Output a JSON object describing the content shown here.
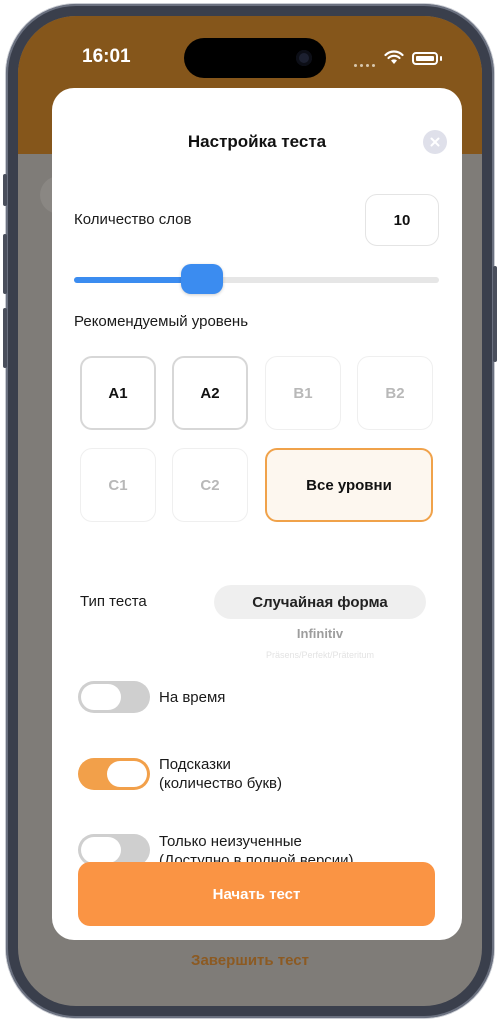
{
  "status_bar": {
    "time": "16:01"
  },
  "background": {
    "finish_label": "Завершить тест"
  },
  "modal": {
    "title": "Настройка теста",
    "word_count": {
      "label": "Количество слов",
      "value": "10",
      "slider_fraction": 0.35
    },
    "level": {
      "label": "Рекомендуемый уровень",
      "options": [
        {
          "label": "A1",
          "state": "enabled"
        },
        {
          "label": "A2",
          "state": "enabled"
        },
        {
          "label": "B1",
          "state": "disabled"
        },
        {
          "label": "B2",
          "state": "disabled"
        },
        {
          "label": "C1",
          "state": "disabled"
        },
        {
          "label": "C2",
          "state": "disabled"
        },
        {
          "label": "Все уровни",
          "state": "selected"
        }
      ]
    },
    "test_type": {
      "label": "Тип теста",
      "selected": "Случайная форма",
      "next_option": "Infinitiv",
      "faint_option": "Präsens/Perfekt/Präteritum"
    },
    "toggles": [
      {
        "label": "На время",
        "on": false
      },
      {
        "label_line1": "Подсказки",
        "label_line2": "(количество букв)",
        "on": true
      },
      {
        "label_line1": "Только неизученные",
        "label_line2": "(Доступно в полной версии)",
        "on": false
      }
    ],
    "start_button": "Начать тест"
  },
  "colors": {
    "accent_orange": "#fa9444",
    "slider_blue": "#3b8cf0",
    "header_brown": "#85561b",
    "selected_border": "#f0a24a"
  },
  "icons": [
    "close-icon",
    "wifi-icon",
    "battery-icon",
    "signal-icon"
  ]
}
